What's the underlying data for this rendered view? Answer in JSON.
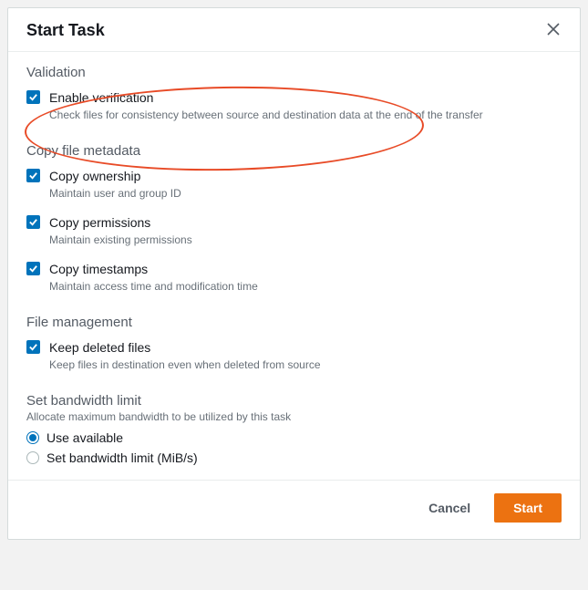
{
  "dialog": {
    "title": "Start Task"
  },
  "validation": {
    "heading": "Validation",
    "enable_verification": {
      "label": "Enable verification",
      "desc": "Check files for consistency between source and destination data at the end of the transfer"
    }
  },
  "metadata": {
    "heading": "Copy file metadata",
    "ownership": {
      "label": "Copy ownership",
      "desc": "Maintain user and group ID"
    },
    "permissions": {
      "label": "Copy permissions",
      "desc": "Maintain existing permissions"
    },
    "timestamps": {
      "label": "Copy timestamps",
      "desc": "Maintain access time and modification time"
    }
  },
  "file_mgmt": {
    "heading": "File management",
    "keep_deleted": {
      "label": "Keep deleted files",
      "desc": "Keep files in destination even when deleted from source"
    }
  },
  "bandwidth": {
    "heading": "Set bandwidth limit",
    "sub": "Allocate maximum bandwidth to be utilized by this task",
    "use_available": "Use available",
    "set_limit": "Set bandwidth limit (MiB/s)"
  },
  "footer": {
    "cancel": "Cancel",
    "start": "Start"
  }
}
